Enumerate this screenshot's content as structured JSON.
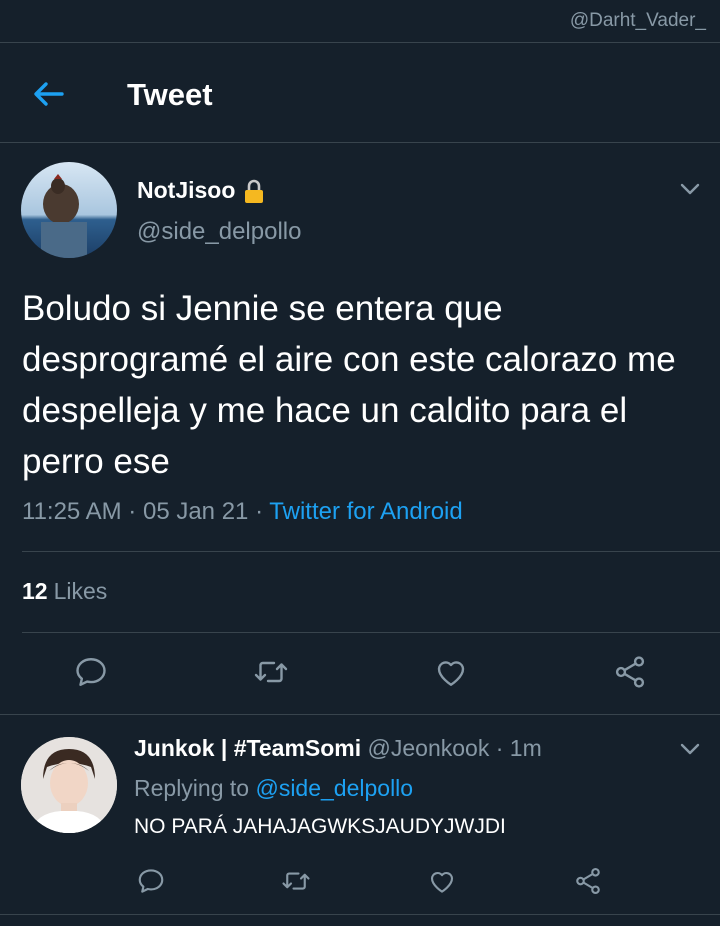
{
  "watermark": "@Darht_Vader_",
  "header": {
    "title": "Tweet",
    "back_icon": "arrow-left-icon"
  },
  "colors": {
    "background": "#15202b",
    "accent": "#1da1f2",
    "secondary_text": "#8899a6",
    "divider": "#38444d"
  },
  "tweet": {
    "author_name": "NotJisoo",
    "author_handle": "@side_delpollo",
    "protected_icon": "lock-icon",
    "text": "Boludo si Jennie se entera que desprogramé el aire con este calorazo me despelleja y me hace un caldito para el perro ese",
    "time": "11:25 AM",
    "date": "05 Jan 21",
    "source": "Twitter for Android",
    "likes_count": "12",
    "likes_label": "Likes"
  },
  "reply": {
    "author_name": "Junkok | #TeamSomi",
    "author_handle": "@Jeonkook",
    "time_ago": "1m",
    "replying_prefix": "Replying to",
    "replying_to": "@side_delpollo",
    "text": "NO PARÁ JAHAJAGWKSJAUDYJWJDI"
  },
  "actions": [
    "reply-icon",
    "retweet-icon",
    "like-icon",
    "share-icon"
  ]
}
